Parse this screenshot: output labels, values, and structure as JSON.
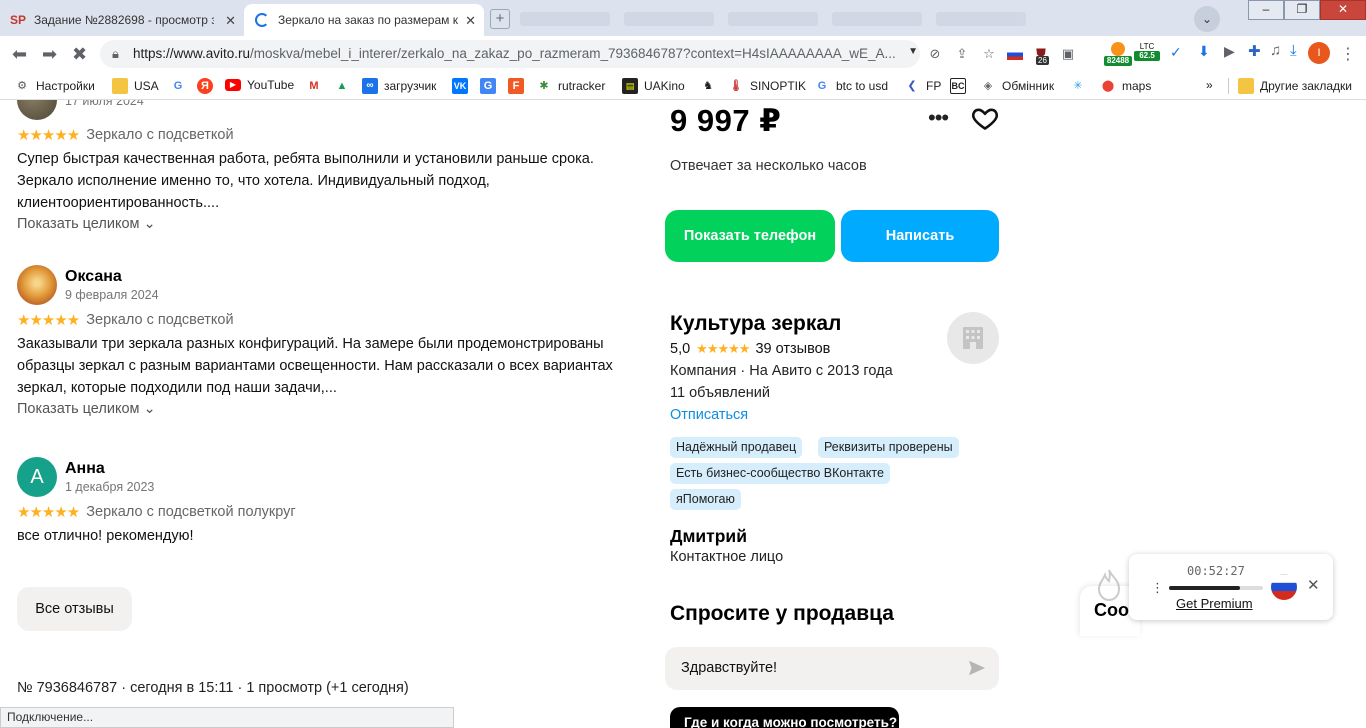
{
  "browser": {
    "tabs": [
      {
        "title": "Задание №2882698 - просмотр за",
        "favicon": "SP"
      },
      {
        "title": "Зеркало на заказ по размерам ку"
      }
    ],
    "url_main": "https://www.avito.ru",
    "url_rest": "/moskva/mebel_i_interer/zerkalo_na_zakaz_po_razmeram_7936846787?context=H4sIAAAAAAAA_wE_A...",
    "ext_badge_1": "26",
    "btc_value": "82488",
    "ltc_label": "LTC",
    "ltc_value": "62.5",
    "profile_initial": "I",
    "bookmarks": [
      {
        "label": "Настройки",
        "icon": "gear-icon"
      },
      {
        "label": "USA",
        "icon": "folder-icon"
      },
      {
        "label": "",
        "icon": "google-icon"
      },
      {
        "label": "",
        "icon": "yandex-icon"
      },
      {
        "label": "YouTube",
        "icon": "youtube-icon"
      },
      {
        "label": "",
        "icon": "gmail-icon"
      },
      {
        "label": "",
        "icon": "drive-icon"
      },
      {
        "label": "загрузчик",
        "icon": "loader-icon"
      },
      {
        "label": "",
        "icon": "vk-icon"
      },
      {
        "label": "",
        "icon": "translate-icon"
      },
      {
        "label": "",
        "icon": "f-icon"
      },
      {
        "label": "rutracker",
        "icon": "rutracker-icon"
      },
      {
        "label": "UAKino",
        "icon": "uakino-icon"
      },
      {
        "label": "",
        "icon": "knight-icon"
      },
      {
        "label": "SINOPTIK",
        "icon": "thermometer-icon"
      },
      {
        "label": "btc to usd",
        "icon": "google-icon"
      },
      {
        "label": "FP",
        "icon": "fp-icon"
      },
      {
        "label": "",
        "icon": "bc-icon"
      },
      {
        "label": "Обмінник",
        "icon": "exchange-icon"
      },
      {
        "label": "",
        "icon": "snowflake-icon"
      },
      {
        "label": "maps",
        "icon": "maps-icon"
      }
    ],
    "bookmarks_more": "»",
    "other_bookmarks": "Другие закладки",
    "status": "Подключение..."
  },
  "reviews": [
    {
      "name": "",
      "date": "17 июля 2024",
      "stars": "★★★★★",
      "product": "Зеркало с подсветкой",
      "text": "Супер быстрая качественная работа, ребята выполнили и установили раньше срока. Зеркало исполнение именно то, что хотела. Индивидуальный подход, клиентоориентированность....",
      "show_more": "Показать целиком ⌄"
    },
    {
      "name": "Оксана",
      "date": "9 февраля 2024",
      "stars": "★★★★★",
      "product": "Зеркало с подсветкой",
      "text": "Заказывали три зеркала разных конфигураций. На замере были продемонстрированы образцы зеркал с разным вариантами освещенности. Нам рассказали о всех вариантах зеркал, которые подходили под наши задачи,...",
      "show_more": "Показать целиком ⌄"
    },
    {
      "name": "Анна",
      "initial": "А",
      "date": "1 декабря 2023",
      "stars": "★★★★★",
      "product": "Зеркало с подсветкой полукруг",
      "text": "все отлично! рекомендую!"
    }
  ],
  "all_reviews_label": "Все отзывы",
  "ad_meta": "№ 7936846787 · сегодня в 15:11 · 1 просмотр (+1 сегодня)",
  "sidebar": {
    "price": "9 997 ₽",
    "more": "•••",
    "responds": "Отвечает за несколько часов",
    "phone_button": "Показать телефон",
    "write_button": "Написать",
    "seller": {
      "name": "Культура зеркал",
      "rating": "5,0",
      "stars": "★★★★★",
      "reviews": "39 отзывов",
      "type": "Компания · На Авито с 2013 года",
      "ads": "11 объявлений",
      "unsubscribe": "Отписаться",
      "badges": [
        "Надёжный продавец",
        "Реквизиты проверены",
        "Есть бизнес-сообщество ВКонтакте",
        "яПомогаю"
      ]
    },
    "contact_name": "Дмитрий",
    "contact_role": "Контактное лицо",
    "ask_title": "Спросите у продавца",
    "ask_value": "Здравствуйте!",
    "quick_question": "Где и когда можно посмотреть?"
  },
  "chat_widget_text": "Соо",
  "vpn": {
    "timer": "00:52:27",
    "premium": "Get Premium",
    "progress": 0.75
  },
  "colors": {
    "green": "#02d15c",
    "blue": "#00aaff",
    "link": "#0a8ee0",
    "star": "#ffb021"
  }
}
